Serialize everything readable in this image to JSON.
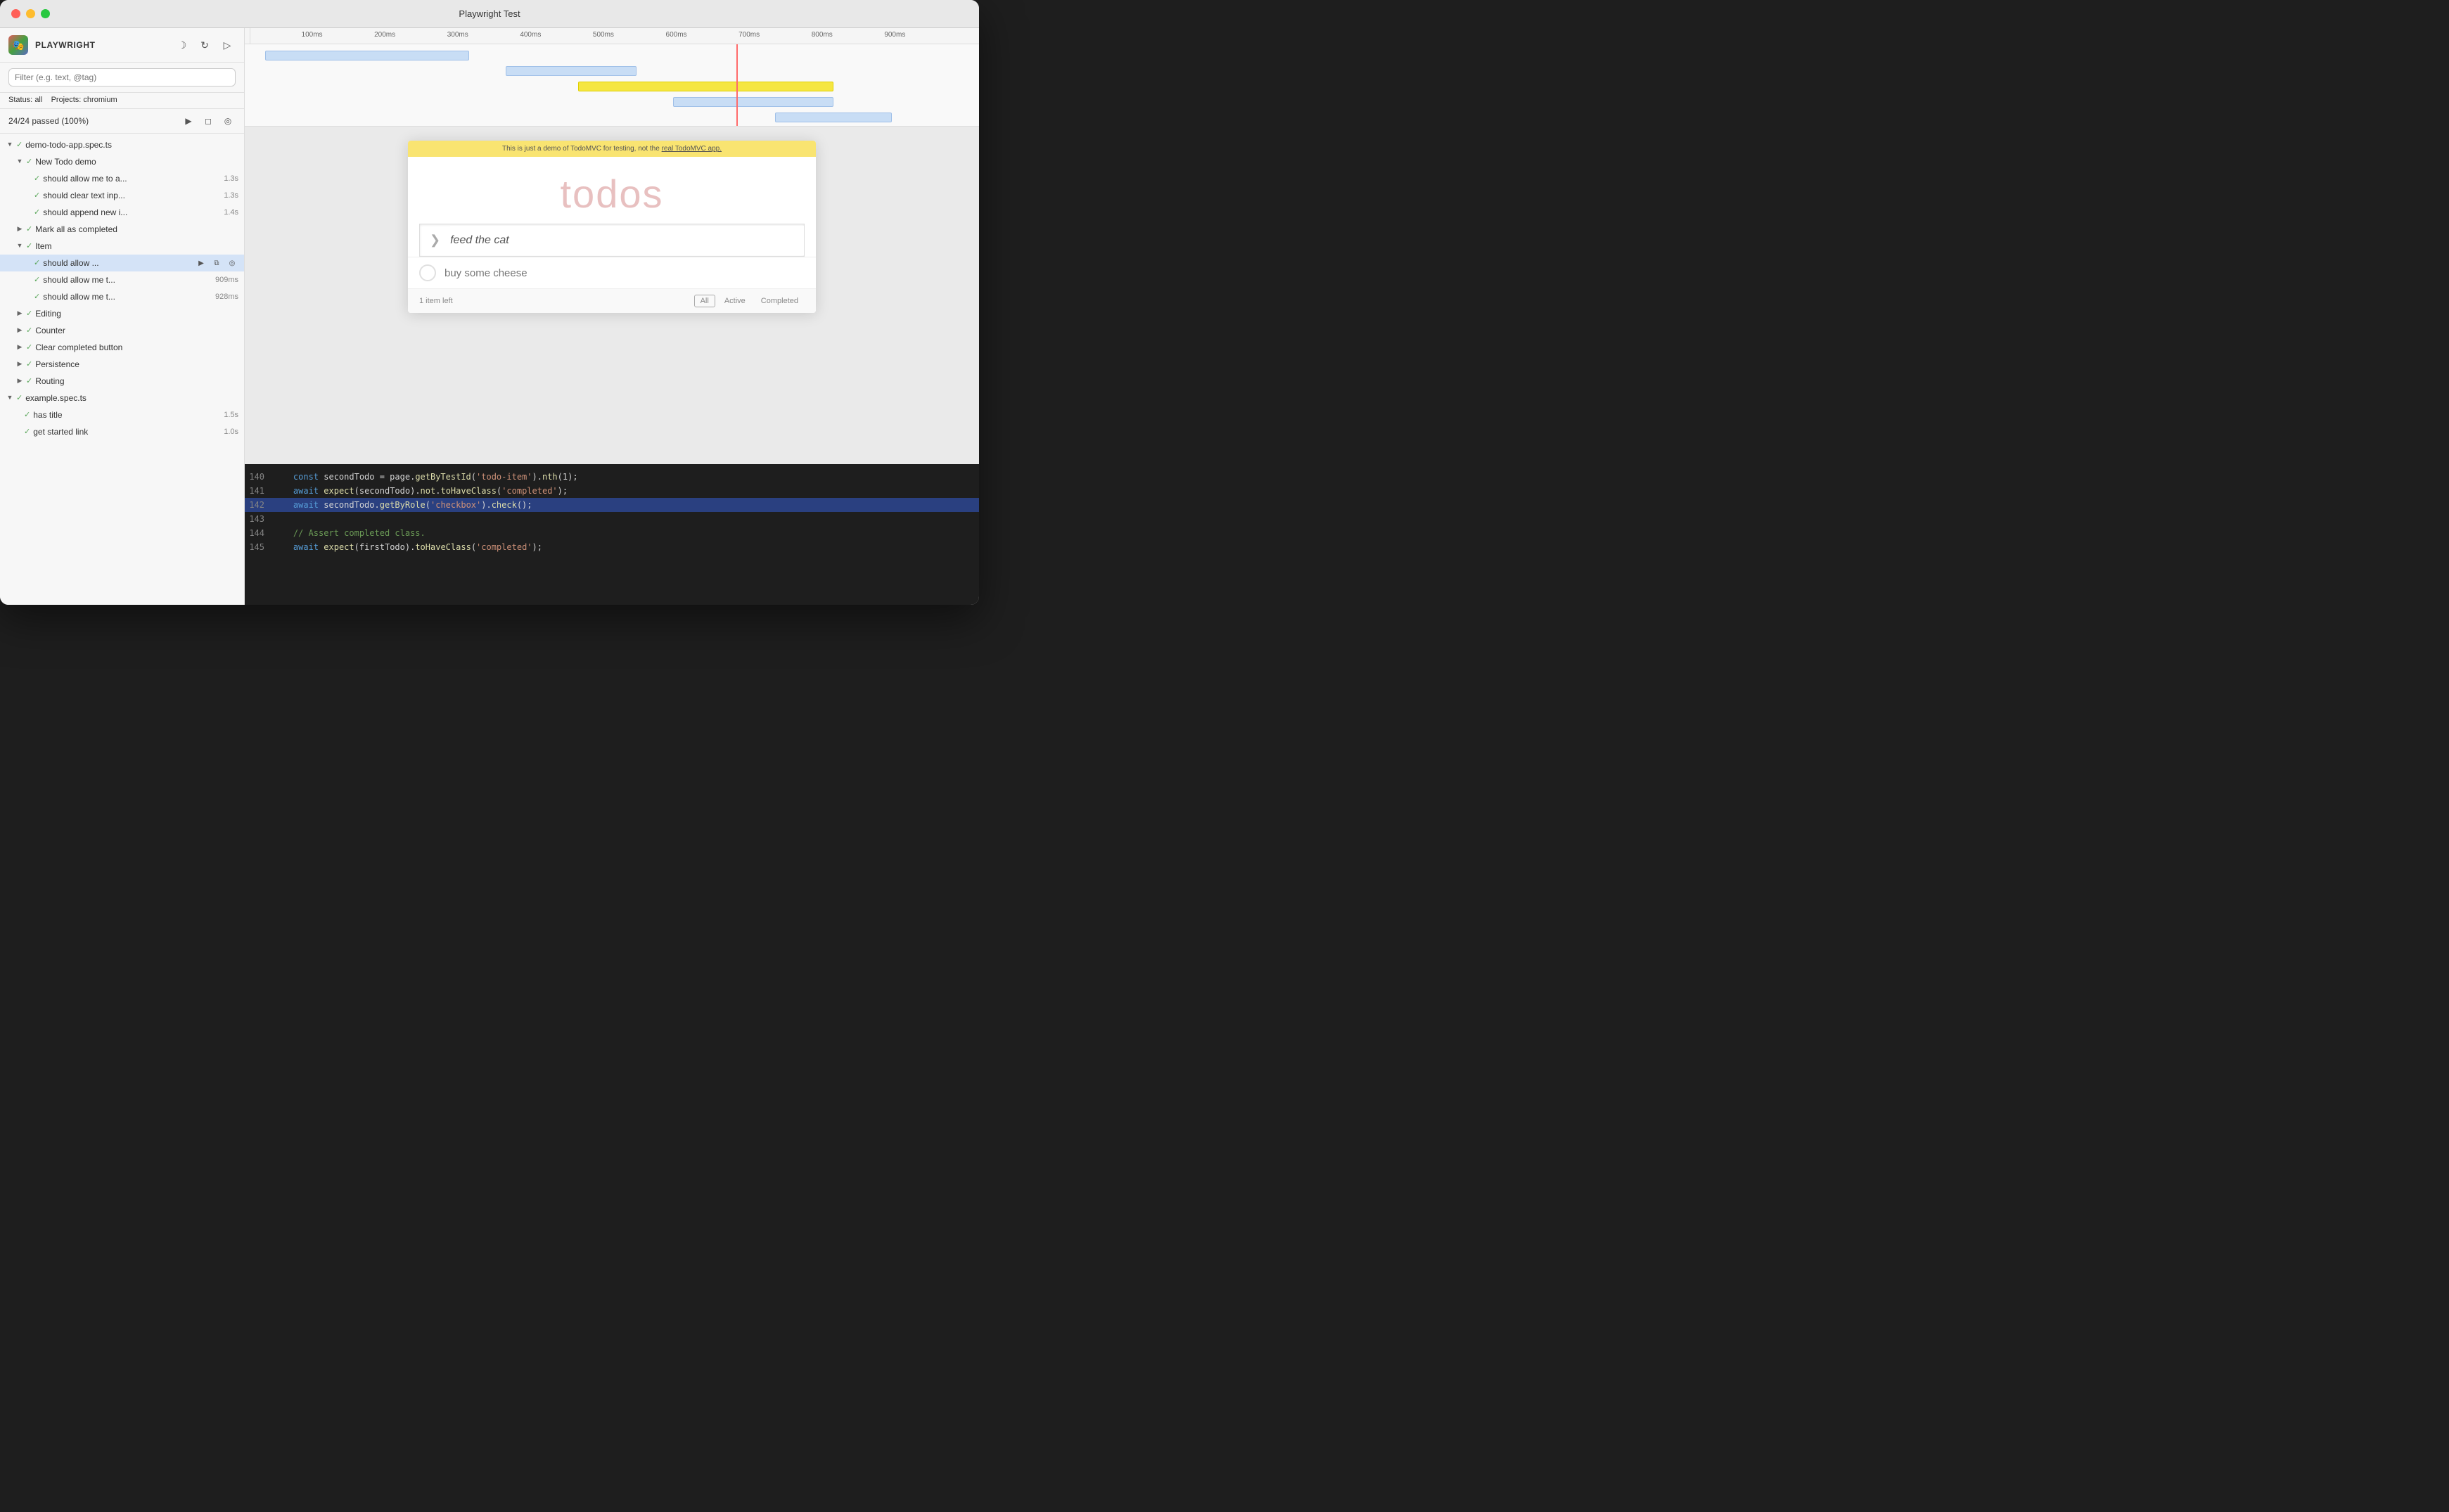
{
  "window": {
    "title": "Playwright Test"
  },
  "sidebar": {
    "brand": "PLAYWRIGHT",
    "filter_placeholder": "Filter (e.g. text, @tag)",
    "status_label": "Status:",
    "status_value": "all",
    "projects_label": "Projects:",
    "projects_value": "chromium",
    "pass_count": "24/24 passed (100%)",
    "test_files": [
      {
        "id": "demo-todo-app",
        "label": "demo-todo-app.spec.ts",
        "expanded": true,
        "passed": true,
        "children": [
          {
            "id": "new-todo-demo",
            "label": "New Todo demo",
            "expanded": true,
            "passed": true,
            "children": [
              {
                "id": "should-allow-me-to-a",
                "label": "should allow me to a...",
                "time": "1.3s",
                "passed": true
              },
              {
                "id": "should-clear-text-inp",
                "label": "should clear text inp...",
                "time": "1.3s",
                "passed": true
              },
              {
                "id": "should-append-new-i",
                "label": "should append new i...",
                "time": "1.4s",
                "passed": true
              }
            ]
          },
          {
            "id": "mark-all-as-completed",
            "label": "Mark all as completed",
            "expanded": false,
            "passed": true,
            "children": []
          },
          {
            "id": "item",
            "label": "Item",
            "expanded": true,
            "passed": true,
            "children": [
              {
                "id": "should-allow-current",
                "label": "should allow ...",
                "time": null,
                "passed": true,
                "selected": true
              },
              {
                "id": "should-allow-me-t-1",
                "label": "should allow me t...",
                "time": "909ms",
                "passed": true
              },
              {
                "id": "should-allow-me-t-2",
                "label": "should allow me t...",
                "time": "928ms",
                "passed": true
              }
            ]
          },
          {
            "id": "editing",
            "label": "Editing",
            "expanded": false,
            "passed": true,
            "children": []
          },
          {
            "id": "counter",
            "label": "Counter",
            "expanded": false,
            "passed": true,
            "children": []
          },
          {
            "id": "clear-completed-button",
            "label": "Clear completed button",
            "expanded": false,
            "passed": true,
            "children": []
          },
          {
            "id": "persistence",
            "label": "Persistence",
            "expanded": false,
            "passed": true,
            "children": []
          },
          {
            "id": "routing",
            "label": "Routing",
            "expanded": false,
            "passed": true,
            "children": []
          }
        ]
      },
      {
        "id": "example-spec",
        "label": "example.spec.ts",
        "expanded": true,
        "passed": true,
        "children": [
          {
            "id": "has-title",
            "label": "has title",
            "time": "1.5s",
            "passed": true
          },
          {
            "id": "get-started-link",
            "label": "get started link",
            "time": "1.0s",
            "passed": true
          }
        ]
      }
    ]
  },
  "timeline": {
    "ticks": [
      "100ms",
      "200ms",
      "300ms",
      "400ms",
      "500ms",
      "600ms",
      "700ms",
      "800ms",
      "900ms"
    ],
    "tick_positions": [
      7,
      17,
      27,
      37,
      47,
      57,
      67,
      77,
      87
    ]
  },
  "preview": {
    "banner_text": "This is just a demo of TodoMVC for testing, not the",
    "banner_link": "real TodoMVC app.",
    "app_title": "todos",
    "input_value": "feed the cat",
    "items": [
      {
        "text": "buy some cheese",
        "completed": false
      }
    ],
    "footer_count": "1 item left",
    "tabs": [
      "All",
      "Active",
      "Completed"
    ],
    "active_tab": "All"
  },
  "code": {
    "lines": [
      {
        "num": "140",
        "content": "    const secondTodo = page.getByTestId('todo-item').nth(1);",
        "highlighted": false
      },
      {
        "num": "141",
        "content": "    await expect(secondTodo).not.toHaveClass('completed');",
        "highlighted": false
      },
      {
        "num": "142",
        "content": "    await secondTodo.getByRole('checkbox').check();",
        "highlighted": true
      },
      {
        "num": "143",
        "content": "",
        "highlighted": false
      },
      {
        "num": "144",
        "content": "    // Assert completed class.",
        "highlighted": false
      },
      {
        "num": "145",
        "content": "    await expect(firstTodo).toHaveClass('completed');",
        "highlighted": false
      }
    ]
  },
  "icons": {
    "moon": "☽",
    "refresh": "↻",
    "forward": "▷",
    "play": "▶",
    "stop": "◻",
    "eye": "◎",
    "copy": "⧉",
    "settings": "⚙"
  }
}
